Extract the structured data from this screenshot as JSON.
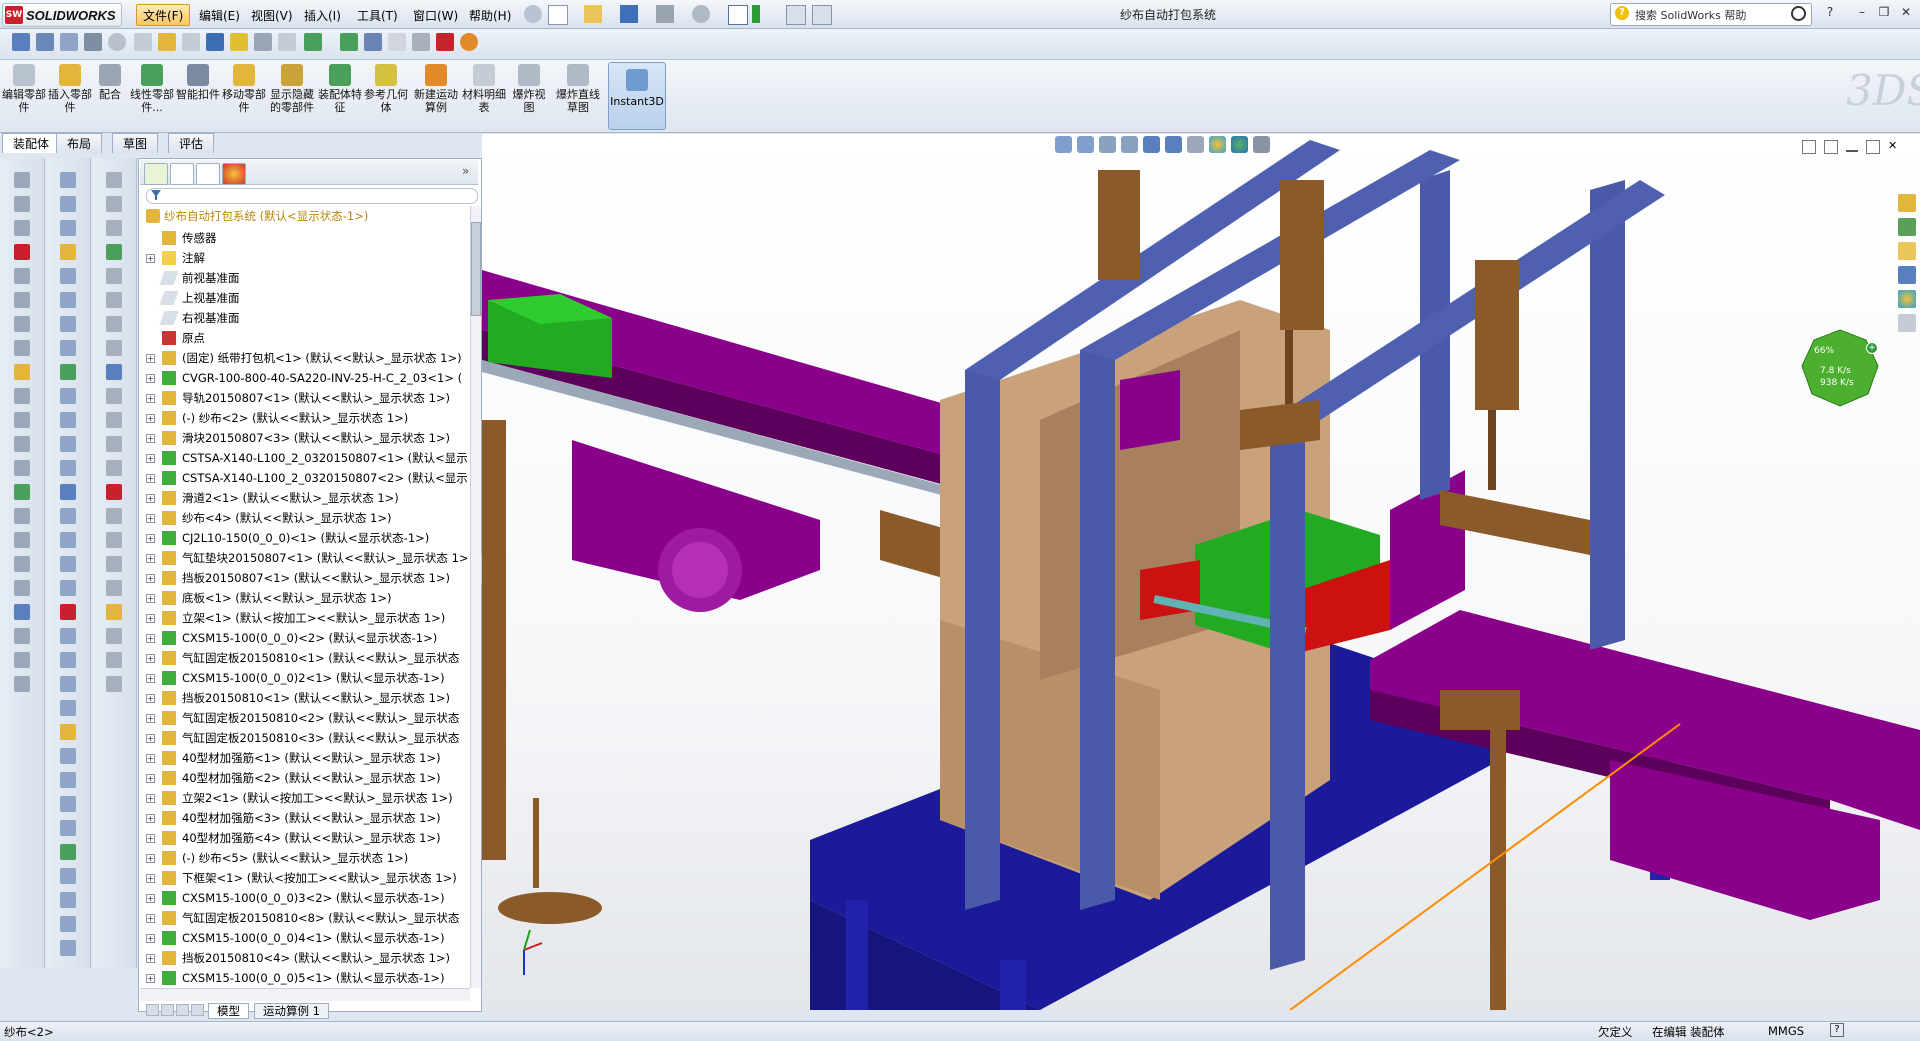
{
  "app": {
    "name": "SOLIDWORKS",
    "window_title": "纱布自动打包系统"
  },
  "menu": [
    "文件(F)",
    "编辑(E)",
    "视图(V)",
    "插入(I)",
    "工具(T)",
    "窗口(W)",
    "帮助(H)"
  ],
  "search": {
    "placeholder": "搜索 SolidWorks 帮助"
  },
  "command_manager": {
    "buttons": [
      {
        "label": "编辑零部件",
        "icon": "edit-component-icon"
      },
      {
        "label": "插入零部件",
        "icon": "insert-component-icon"
      },
      {
        "label": "配合",
        "icon": "mate-icon"
      },
      {
        "label": "线性零部件...",
        "icon": "linear-pattern-icon"
      },
      {
        "label": "智能扣件",
        "icon": "smart-fasteners-icon"
      },
      {
        "label": "移动零部件",
        "icon": "move-component-icon"
      },
      {
        "label": "显示隐藏的零部件",
        "icon": "show-hidden-icon"
      },
      {
        "label": "装配体特征",
        "icon": "assembly-features-icon"
      },
      {
        "label": "参考几何体",
        "icon": "reference-geometry-icon"
      },
      {
        "label": "新建运动算例",
        "icon": "new-motion-study-icon"
      },
      {
        "label": "材料明细表",
        "icon": "bom-icon"
      },
      {
        "label": "爆炸视图",
        "icon": "exploded-view-icon"
      },
      {
        "label": "爆炸直线草图",
        "icon": "explode-line-sketch-icon"
      }
    ],
    "instant3d": "Instant3D",
    "tabs": [
      "装配体",
      "布局",
      "草图",
      "评估"
    ]
  },
  "feature_tree": {
    "root": "纱布自动打包系统 (默认<显示状态-1>)",
    "items": [
      {
        "text": "传感器",
        "type": "folder",
        "expand": false
      },
      {
        "text": "注解",
        "type": "annotation",
        "expand": true
      },
      {
        "text": "前视基准面",
        "type": "plane",
        "expand": false
      },
      {
        "text": "上视基准面",
        "type": "plane",
        "expand": false
      },
      {
        "text": "右视基准面",
        "type": "plane",
        "expand": false
      },
      {
        "text": "原点",
        "type": "origin",
        "expand": false
      },
      {
        "text": "(固定) 纸带打包机<1> (默认<<默认>_显示状态 1>)",
        "type": "part",
        "expand": true
      },
      {
        "text": "CVGR-100-800-40-SA220-INV-25-H-C_2_03<1> (",
        "type": "assembly",
        "expand": true
      },
      {
        "text": "导轨20150807<1> (默认<<默认>_显示状态 1>)",
        "type": "part",
        "expand": true
      },
      {
        "text": "(-) 纱布<2> (默认<<默认>_显示状态 1>)",
        "type": "part",
        "expand": true
      },
      {
        "text": "滑块20150807<3> (默认<<默认>_显示状态 1>)",
        "type": "part",
        "expand": true
      },
      {
        "text": "CSTSA-X140-L100_2_0320150807<1> (默认<显示",
        "type": "assembly",
        "expand": true
      },
      {
        "text": "CSTSA-X140-L100_2_0320150807<2> (默认<显示",
        "type": "assembly",
        "expand": true
      },
      {
        "text": "滑道2<1> (默认<<默认>_显示状态 1>)",
        "type": "part",
        "expand": true
      },
      {
        "text": "纱布<4> (默认<<默认>_显示状态 1>)",
        "type": "part",
        "expand": true
      },
      {
        "text": "CJ2L10-150(0_0_0)<1> (默认<显示状态-1>)",
        "type": "assembly",
        "expand": true
      },
      {
        "text": "气缸垫块20150807<1> (默认<<默认>_显示状态 1>",
        "type": "part",
        "expand": true
      },
      {
        "text": "挡板20150807<1> (默认<<默认>_显示状态 1>)",
        "type": "part",
        "expand": true
      },
      {
        "text": "底板<1> (默认<<默认>_显示状态 1>)",
        "type": "part",
        "expand": true
      },
      {
        "text": "立架<1> (默认<按加工><<默认>_显示状态 1>)",
        "type": "part",
        "expand": true
      },
      {
        "text": "CXSM15-100(0_0_0)<2> (默认<显示状态-1>)",
        "type": "assembly",
        "expand": true
      },
      {
        "text": "气缸固定板20150810<1> (默认<<默认>_显示状态",
        "type": "part",
        "expand": true
      },
      {
        "text": "CXSM15-100(0_0_0)2<1> (默认<显示状态-1>)",
        "type": "assembly",
        "expand": true
      },
      {
        "text": "挡板20150810<1> (默认<<默认>_显示状态 1>)",
        "type": "part",
        "expand": true
      },
      {
        "text": "气缸固定板20150810<2> (默认<<默认>_显示状态",
        "type": "part",
        "expand": true
      },
      {
        "text": "气缸固定板20150810<3> (默认<<默认>_显示状态",
        "type": "part",
        "expand": true
      },
      {
        "text": "40型材加强筋<1> (默认<<默认>_显示状态 1>)",
        "type": "part",
        "expand": true
      },
      {
        "text": "40型材加强筋<2> (默认<<默认>_显示状态 1>)",
        "type": "part",
        "expand": true
      },
      {
        "text": "立架2<1> (默认<按加工><<默认>_显示状态 1>)",
        "type": "part",
        "expand": true
      },
      {
        "text": "40型材加强筋<3> (默认<<默认>_显示状态 1>)",
        "type": "part",
        "expand": true
      },
      {
        "text": "40型材加强筋<4> (默认<<默认>_显示状态 1>)",
        "type": "part",
        "expand": true
      },
      {
        "text": "(-) 纱布<5> (默认<<默认>_显示状态 1>)",
        "type": "part",
        "expand": true
      },
      {
        "text": "下框架<1> (默认<按加工><<默认>_显示状态 1>)",
        "type": "part",
        "expand": true
      },
      {
        "text": "CXSM15-100(0_0_0)3<2> (默认<显示状态-1>)",
        "type": "assembly",
        "expand": true
      },
      {
        "text": "气缸固定板20150810<8> (默认<<默认>_显示状态",
        "type": "part",
        "expand": true
      },
      {
        "text": "CXSM15-100(0_0_0)4<1> (默认<显示状态-1>)",
        "type": "assembly",
        "expand": true
      },
      {
        "text": "挡板20150810<4> (默认<<默认>_显示状态 1>)",
        "type": "part",
        "expand": true
      },
      {
        "text": "CXSM15-100(0_0_0)5<1> (默认<显示状态-1>)",
        "type": "assembly",
        "expand": true
      }
    ]
  },
  "bottom_tabs": [
    "模型",
    "运动算例 1"
  ],
  "performance": {
    "percent": "66%",
    "up": "7.8 K/s",
    "down": "938 K/s"
  },
  "status": {
    "left": "纱布<2>",
    "under_defined": "欠定义",
    "editing": "在编辑 装配体",
    "units": "MMGS"
  },
  "colors": {
    "accent_menu": "#f7c765",
    "frame_blue": "#4a5aa8",
    "base_blue": "#1a1a9a",
    "conveyor_purple": "#8b008b",
    "wood_brown": "#8b5a2b",
    "box_green": "#22aa22",
    "tan": "#c9a27c"
  }
}
